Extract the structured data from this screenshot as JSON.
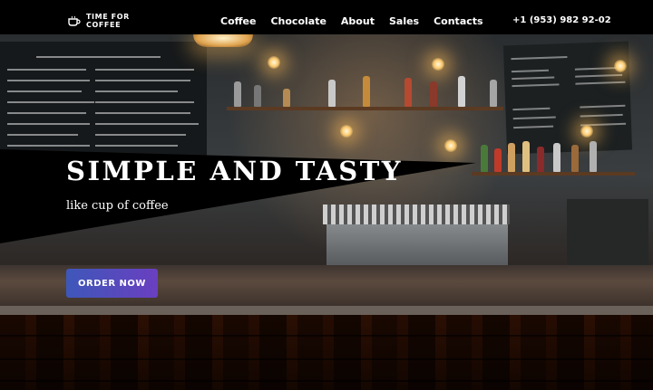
{
  "brand": {
    "line1": "TIME FOR",
    "line2": "COFFEE",
    "icon": "coffee-cup-icon"
  },
  "nav": {
    "items": [
      "Coffee",
      "Chocolate",
      "About",
      "Sales",
      "Contacts"
    ]
  },
  "phone": "+1 (953) 982 92-02",
  "hero": {
    "title": "SIMPLE AND TASTY",
    "subtitle": "like cup of coffee",
    "cta_label": "ORDER NOW"
  },
  "colors": {
    "header_bg": "#000000",
    "cta_gradient_start": "#3e57b9",
    "cta_gradient_end": "#6a3fc0"
  }
}
